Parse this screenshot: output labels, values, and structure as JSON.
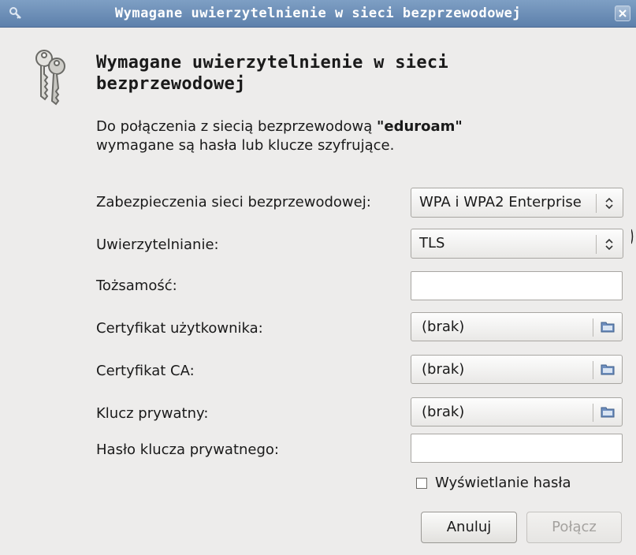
{
  "window": {
    "title": "Wymagane uwierzytelnienie w sieci bezprzewodowej"
  },
  "dialog": {
    "heading": "Wymagane uwierzytelnienie w sieci bezprzewodowej",
    "description_prefix": "Do połączenia z siecią bezprzewodową ",
    "network_name": "\"eduroam\"",
    "description_suffix": "wymagane są hasła lub klucze szyfrujące."
  },
  "form": {
    "security_label": "Zabezpieczenia sieci bezprzewodowej:",
    "security_value": "WPA i WPA2 Enterprise",
    "auth_label": "Uwierzytelnianie:",
    "auth_value": "TLS",
    "identity_label": "Tożsamość:",
    "identity_value": "",
    "user_cert_label": "Certyfikat użytkownika:",
    "user_cert_value": "(brak)",
    "ca_cert_label": "Certyfikat CA:",
    "ca_cert_value": "(brak)",
    "private_key_label": "Klucz prywatny:",
    "private_key_value": "(brak)",
    "private_key_password_label": "Hasło klucza prywatnego:",
    "private_key_password_value": "",
    "show_password_label": "Wyświetlanie hasła",
    "show_password_checked": false
  },
  "buttons": {
    "cancel": "Anuluj",
    "connect": "Połącz"
  },
  "icons": {
    "title_icon": "key-icon",
    "dialog_icon": "keys-icon",
    "close_icon": "close-icon",
    "combo_arrows": "chevron-updown-icon",
    "file_picker": "folder-icon"
  }
}
